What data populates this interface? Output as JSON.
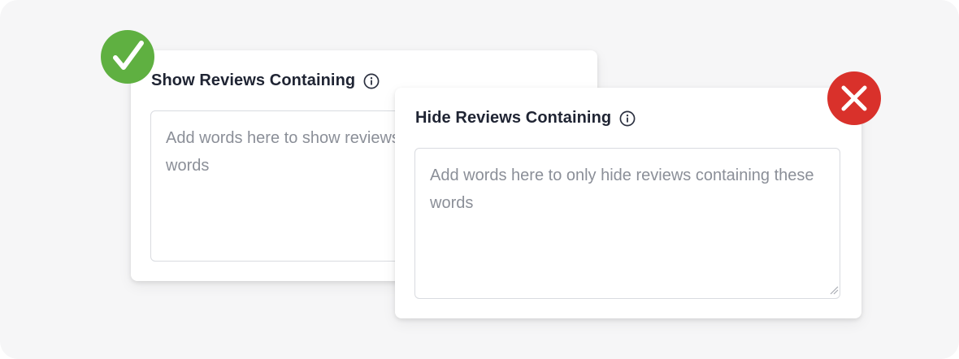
{
  "colors": {
    "background": "#f6f6f7",
    "card": "#ffffff",
    "title_text": "#1f2433",
    "placeholder_text": "#8b8f98",
    "input_border": "#d9dbe0",
    "show_badge": "#5fb041",
    "hide_badge": "#d9312b"
  },
  "show_panel": {
    "title": "Show Reviews Containing",
    "info_icon": "info-circle-icon",
    "badge_icon": "checkmark-icon",
    "textarea_placeholder": "Add words here to show reviews containing these words",
    "textarea_value": ""
  },
  "hide_panel": {
    "title": "Hide Reviews Containing",
    "info_icon": "info-circle-icon",
    "badge_icon": "close-x-icon",
    "textarea_placeholder": "Add words here to only hide reviews containing these words",
    "textarea_value": ""
  }
}
